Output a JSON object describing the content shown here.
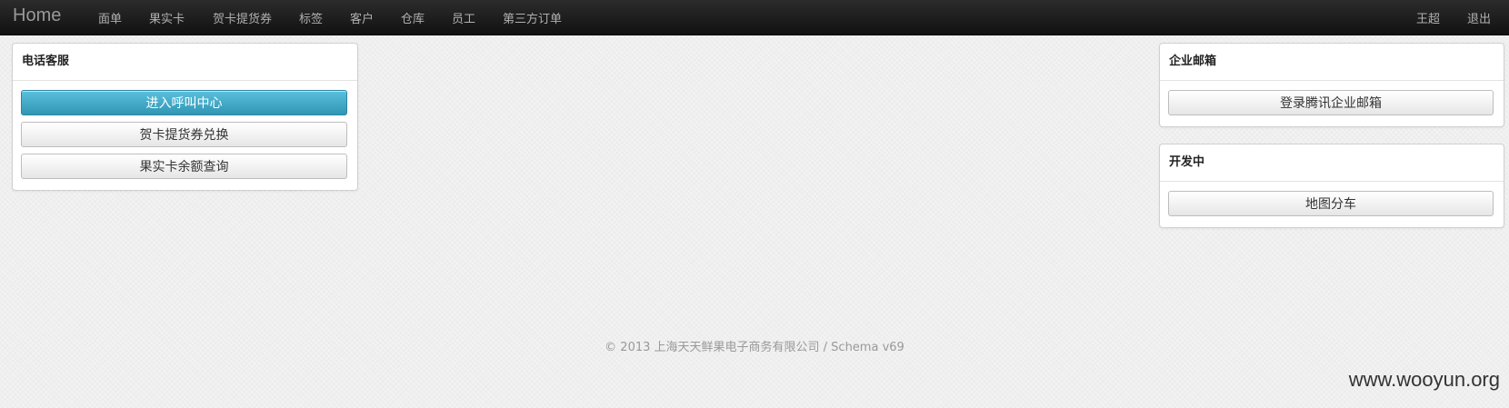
{
  "navbar": {
    "brand": "Home",
    "items": [
      {
        "label": "面单"
      },
      {
        "label": "果实卡"
      },
      {
        "label": "贺卡提货券"
      },
      {
        "label": "标签"
      },
      {
        "label": "客户"
      },
      {
        "label": "仓库"
      },
      {
        "label": "员工"
      },
      {
        "label": "第三方订单"
      }
    ],
    "user": "王超",
    "logout": "退出"
  },
  "panels": {
    "phone_service": {
      "title": "电话客服",
      "buttons": [
        {
          "label": "进入呼叫中心"
        },
        {
          "label": "贺卡提货券兑换"
        },
        {
          "label": "果实卡余额查询"
        }
      ]
    },
    "enterprise_mail": {
      "title": "企业邮箱",
      "buttons": [
        {
          "label": "登录腾讯企业邮箱"
        }
      ]
    },
    "in_development": {
      "title": "开发中",
      "buttons": [
        {
          "label": "地图分车"
        }
      ]
    }
  },
  "footer": "© 2013 上海天天鲜果电子商务有限公司 / Schema v69",
  "watermark": "www.wooyun.org",
  "colors": {
    "navbar": "#1b1b1b",
    "primary_button": "#49afcd",
    "background": "#efefef"
  }
}
